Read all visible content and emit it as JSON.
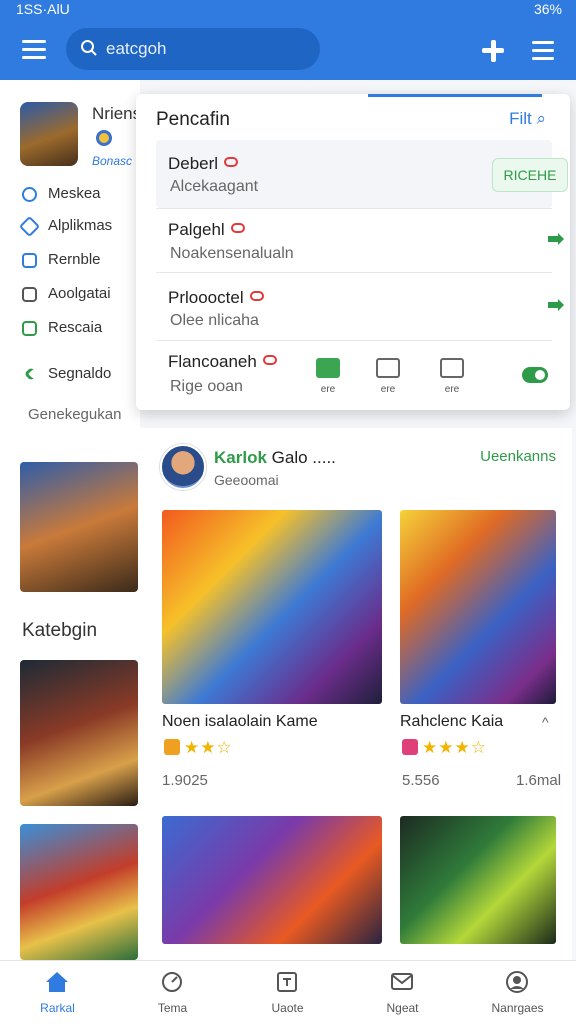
{
  "status": {
    "left": "1SS·AlU",
    "right": "36%"
  },
  "search": {
    "placeholder": "eatcgoh"
  },
  "sidebar": {
    "app_name": "Nriens",
    "app_sub": "Bonasc",
    "items": [
      {
        "label": "Meskea",
        "icon": "puzzle-icon"
      },
      {
        "label": "Alplikmas",
        "icon": "app-icon"
      },
      {
        "label": "Rernble",
        "icon": "list-icon"
      },
      {
        "label": "Aoolgatai",
        "icon": "doc-icon"
      },
      {
        "label": "Rescaia",
        "icon": "grid-icon"
      },
      {
        "label": "Segnaldo",
        "icon": "check-icon"
      }
    ],
    "section_label": "Genekegukan",
    "heading": "Katebgin"
  },
  "dropdown": {
    "title": "Pencafin",
    "filter_label": "Filt",
    "rows": [
      {
        "name": "Deberl",
        "desc": "Alcekaagant",
        "action": "RICEHE"
      },
      {
        "name": "Palgehl",
        "desc": "Noakensenalualn"
      },
      {
        "name": "Prloooctel",
        "desc": "Olee nlicaha"
      },
      {
        "name": "Flancoaneh",
        "desc": "Rige ooan"
      }
    ],
    "mini_labels": [
      "ere",
      "ere",
      "ere"
    ]
  },
  "card": {
    "author_name": "Karlok",
    "author_suffix": "Galo .....",
    "author_sub": "Geeoomai",
    "see_all": "Ueenkanns",
    "games": [
      {
        "title": "Noen isalaolain Kame",
        "stat_left": "1.9025"
      },
      {
        "title": "Rahclenc Kaia",
        "stat_left": "5.556",
        "stat_right": "1.6mal"
      }
    ]
  },
  "bottom_nav": [
    {
      "label": "Rarkal",
      "icon": "home-icon"
    },
    {
      "label": "Tema",
      "icon": "gauge-icon"
    },
    {
      "label": "Uaote",
      "icon": "update-icon"
    },
    {
      "label": "Ngeat",
      "icon": "mail-icon"
    },
    {
      "label": "Nanrgaes",
      "icon": "profile-icon"
    }
  ],
  "colors": {
    "primary": "#2f7be0",
    "green": "#2e9b48",
    "red": "#e03a3a"
  }
}
